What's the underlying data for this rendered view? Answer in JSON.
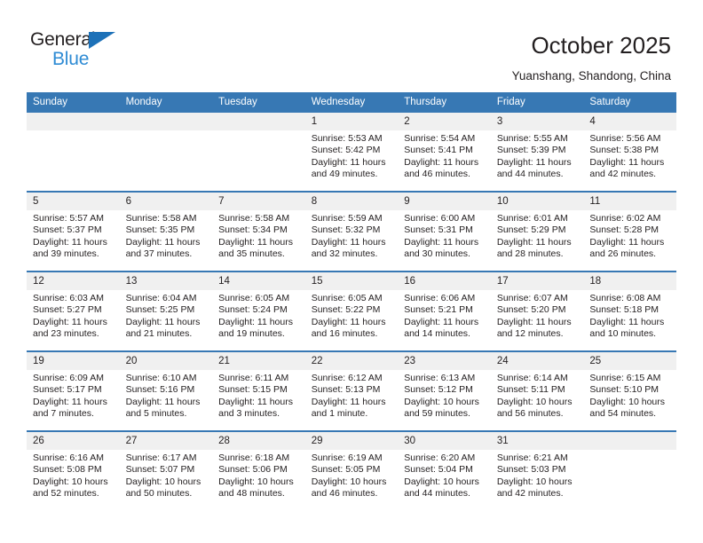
{
  "brand": {
    "name_top": "General",
    "name_bottom": "Blue",
    "accent_color": "#2e8bd4",
    "triangle_color": "#1d71b8",
    "triangle_icon": "triangle-icon"
  },
  "header": {
    "title": "October 2025",
    "subtitle": "Yuanshang, Shandong, China"
  },
  "calendar": {
    "header_bg": "#3778b4",
    "daynum_bg": "#f0f0f0",
    "weekdays": [
      "Sunday",
      "Monday",
      "Tuesday",
      "Wednesday",
      "Thursday",
      "Friday",
      "Saturday"
    ],
    "weeks": [
      [
        {
          "day": "",
          "empty": true
        },
        {
          "day": "",
          "empty": true
        },
        {
          "day": "",
          "empty": true
        },
        {
          "day": "1",
          "sunrise": "Sunrise: 5:53 AM",
          "sunset": "Sunset: 5:42 PM",
          "daylight_1": "Daylight: 11 hours",
          "daylight_2": "and 49 minutes."
        },
        {
          "day": "2",
          "sunrise": "Sunrise: 5:54 AM",
          "sunset": "Sunset: 5:41 PM",
          "daylight_1": "Daylight: 11 hours",
          "daylight_2": "and 46 minutes."
        },
        {
          "day": "3",
          "sunrise": "Sunrise: 5:55 AM",
          "sunset": "Sunset: 5:39 PM",
          "daylight_1": "Daylight: 11 hours",
          "daylight_2": "and 44 minutes."
        },
        {
          "day": "4",
          "sunrise": "Sunrise: 5:56 AM",
          "sunset": "Sunset: 5:38 PM",
          "daylight_1": "Daylight: 11 hours",
          "daylight_2": "and 42 minutes."
        }
      ],
      [
        {
          "day": "5",
          "sunrise": "Sunrise: 5:57 AM",
          "sunset": "Sunset: 5:37 PM",
          "daylight_1": "Daylight: 11 hours",
          "daylight_2": "and 39 minutes."
        },
        {
          "day": "6",
          "sunrise": "Sunrise: 5:58 AM",
          "sunset": "Sunset: 5:35 PM",
          "daylight_1": "Daylight: 11 hours",
          "daylight_2": "and 37 minutes."
        },
        {
          "day": "7",
          "sunrise": "Sunrise: 5:58 AM",
          "sunset": "Sunset: 5:34 PM",
          "daylight_1": "Daylight: 11 hours",
          "daylight_2": "and 35 minutes."
        },
        {
          "day": "8",
          "sunrise": "Sunrise: 5:59 AM",
          "sunset": "Sunset: 5:32 PM",
          "daylight_1": "Daylight: 11 hours",
          "daylight_2": "and 32 minutes."
        },
        {
          "day": "9",
          "sunrise": "Sunrise: 6:00 AM",
          "sunset": "Sunset: 5:31 PM",
          "daylight_1": "Daylight: 11 hours",
          "daylight_2": "and 30 minutes."
        },
        {
          "day": "10",
          "sunrise": "Sunrise: 6:01 AM",
          "sunset": "Sunset: 5:29 PM",
          "daylight_1": "Daylight: 11 hours",
          "daylight_2": "and 28 minutes."
        },
        {
          "day": "11",
          "sunrise": "Sunrise: 6:02 AM",
          "sunset": "Sunset: 5:28 PM",
          "daylight_1": "Daylight: 11 hours",
          "daylight_2": "and 26 minutes."
        }
      ],
      [
        {
          "day": "12",
          "sunrise": "Sunrise: 6:03 AM",
          "sunset": "Sunset: 5:27 PM",
          "daylight_1": "Daylight: 11 hours",
          "daylight_2": "and 23 minutes."
        },
        {
          "day": "13",
          "sunrise": "Sunrise: 6:04 AM",
          "sunset": "Sunset: 5:25 PM",
          "daylight_1": "Daylight: 11 hours",
          "daylight_2": "and 21 minutes."
        },
        {
          "day": "14",
          "sunrise": "Sunrise: 6:05 AM",
          "sunset": "Sunset: 5:24 PM",
          "daylight_1": "Daylight: 11 hours",
          "daylight_2": "and 19 minutes."
        },
        {
          "day": "15",
          "sunrise": "Sunrise: 6:05 AM",
          "sunset": "Sunset: 5:22 PM",
          "daylight_1": "Daylight: 11 hours",
          "daylight_2": "and 16 minutes."
        },
        {
          "day": "16",
          "sunrise": "Sunrise: 6:06 AM",
          "sunset": "Sunset: 5:21 PM",
          "daylight_1": "Daylight: 11 hours",
          "daylight_2": "and 14 minutes."
        },
        {
          "day": "17",
          "sunrise": "Sunrise: 6:07 AM",
          "sunset": "Sunset: 5:20 PM",
          "daylight_1": "Daylight: 11 hours",
          "daylight_2": "and 12 minutes."
        },
        {
          "day": "18",
          "sunrise": "Sunrise: 6:08 AM",
          "sunset": "Sunset: 5:18 PM",
          "daylight_1": "Daylight: 11 hours",
          "daylight_2": "and 10 minutes."
        }
      ],
      [
        {
          "day": "19",
          "sunrise": "Sunrise: 6:09 AM",
          "sunset": "Sunset: 5:17 PM",
          "daylight_1": "Daylight: 11 hours",
          "daylight_2": "and 7 minutes."
        },
        {
          "day": "20",
          "sunrise": "Sunrise: 6:10 AM",
          "sunset": "Sunset: 5:16 PM",
          "daylight_1": "Daylight: 11 hours",
          "daylight_2": "and 5 minutes."
        },
        {
          "day": "21",
          "sunrise": "Sunrise: 6:11 AM",
          "sunset": "Sunset: 5:15 PM",
          "daylight_1": "Daylight: 11 hours",
          "daylight_2": "and 3 minutes."
        },
        {
          "day": "22",
          "sunrise": "Sunrise: 6:12 AM",
          "sunset": "Sunset: 5:13 PM",
          "daylight_1": "Daylight: 11 hours",
          "daylight_2": "and 1 minute."
        },
        {
          "day": "23",
          "sunrise": "Sunrise: 6:13 AM",
          "sunset": "Sunset: 5:12 PM",
          "daylight_1": "Daylight: 10 hours",
          "daylight_2": "and 59 minutes."
        },
        {
          "day": "24",
          "sunrise": "Sunrise: 6:14 AM",
          "sunset": "Sunset: 5:11 PM",
          "daylight_1": "Daylight: 10 hours",
          "daylight_2": "and 56 minutes."
        },
        {
          "day": "25",
          "sunrise": "Sunrise: 6:15 AM",
          "sunset": "Sunset: 5:10 PM",
          "daylight_1": "Daylight: 10 hours",
          "daylight_2": "and 54 minutes."
        }
      ],
      [
        {
          "day": "26",
          "sunrise": "Sunrise: 6:16 AM",
          "sunset": "Sunset: 5:08 PM",
          "daylight_1": "Daylight: 10 hours",
          "daylight_2": "and 52 minutes."
        },
        {
          "day": "27",
          "sunrise": "Sunrise: 6:17 AM",
          "sunset": "Sunset: 5:07 PM",
          "daylight_1": "Daylight: 10 hours",
          "daylight_2": "and 50 minutes."
        },
        {
          "day": "28",
          "sunrise": "Sunrise: 6:18 AM",
          "sunset": "Sunset: 5:06 PM",
          "daylight_1": "Daylight: 10 hours",
          "daylight_2": "and 48 minutes."
        },
        {
          "day": "29",
          "sunrise": "Sunrise: 6:19 AM",
          "sunset": "Sunset: 5:05 PM",
          "daylight_1": "Daylight: 10 hours",
          "daylight_2": "and 46 minutes."
        },
        {
          "day": "30",
          "sunrise": "Sunrise: 6:20 AM",
          "sunset": "Sunset: 5:04 PM",
          "daylight_1": "Daylight: 10 hours",
          "daylight_2": "and 44 minutes."
        },
        {
          "day": "31",
          "sunrise": "Sunrise: 6:21 AM",
          "sunset": "Sunset: 5:03 PM",
          "daylight_1": "Daylight: 10 hours",
          "daylight_2": "and 42 minutes."
        },
        {
          "day": "",
          "empty": true
        }
      ]
    ]
  }
}
